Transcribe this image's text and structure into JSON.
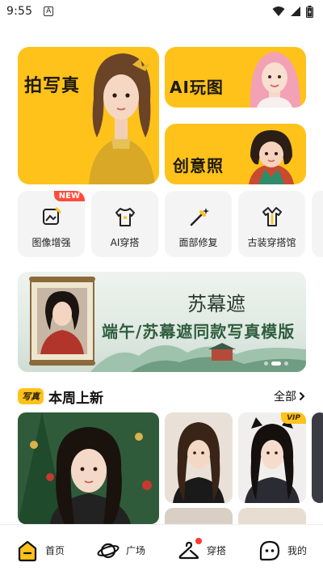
{
  "status_bar": {
    "time": "9:55",
    "notification_icon": "A"
  },
  "hero": {
    "big": {
      "label": "拍写真"
    },
    "ai": {
      "label": "AI玩图"
    },
    "creative": {
      "label": "创意照"
    }
  },
  "tools": [
    {
      "label": "图像增强",
      "icon": "image-enhance-icon",
      "badge": "NEW"
    },
    {
      "label": "AI穿搭",
      "icon": "shirt-icon"
    },
    {
      "label": "面部修复",
      "icon": "magic-wand-icon"
    },
    {
      "label": "古装穿搭馆",
      "icon": "costume-icon"
    }
  ],
  "banner": {
    "script_text": "苏幕遮",
    "title": "端午/苏幕遮同款写真模版",
    "slides": 3,
    "active_slide": 1
  },
  "section": {
    "tag": "写真",
    "title": "本周上新",
    "see_all": "全部"
  },
  "gallery": {
    "vip_badge": "VIP"
  },
  "bottom_nav": [
    {
      "label": "首页",
      "icon": "home-icon"
    },
    {
      "label": "广场",
      "icon": "planet-icon"
    },
    {
      "label": "穿搭",
      "icon": "hanger-icon",
      "dot": true
    },
    {
      "label": "我的",
      "icon": "profile-icon"
    }
  ],
  "colors": {
    "accent": "#ffc21a",
    "badge_red": "#ff4d3b",
    "banner_green": "#2f5d3e"
  }
}
